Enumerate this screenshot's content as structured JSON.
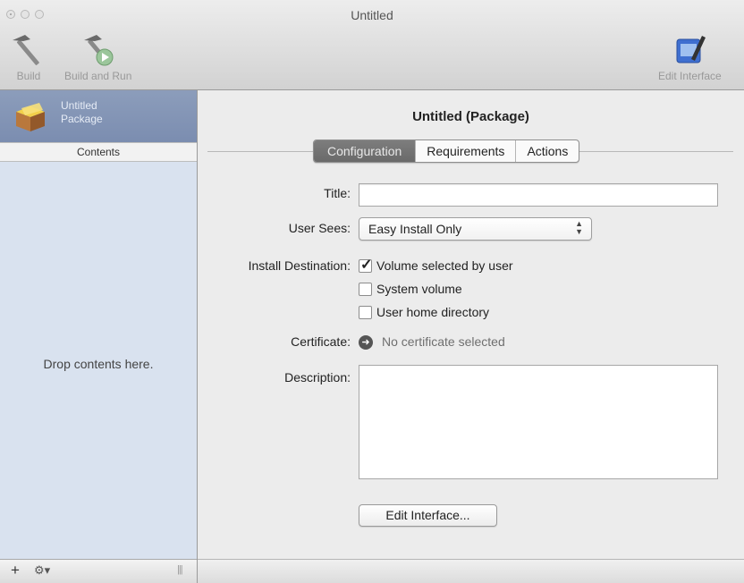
{
  "window": {
    "title": "Untitled"
  },
  "toolbar": {
    "build_label": "Build",
    "build_run_label": "Build and Run",
    "edit_interface_label": "Edit Interface"
  },
  "sidebar": {
    "item": {
      "line1": "Untitled",
      "line2": "Package",
      "icon": "package-icon"
    },
    "header": "Contents",
    "placeholder": "Drop contents here.",
    "footer": {
      "add": "+",
      "gear": "⚙▾",
      "resize": "|||"
    }
  },
  "main": {
    "title": "Untitled (Package)",
    "tabs": [
      {
        "label": "Configuration",
        "active": true
      },
      {
        "label": "Requirements",
        "active": false
      },
      {
        "label": "Actions",
        "active": false
      }
    ],
    "form": {
      "title_label": "Title:",
      "title_value": "",
      "user_sees_label": "User Sees:",
      "user_sees_value": "Easy Install Only",
      "install_destination_label": "Install Destination:",
      "destinations": [
        {
          "label": "Volume selected by user",
          "checked": true
        },
        {
          "label": "System volume",
          "checked": false
        },
        {
          "label": "User home directory",
          "checked": false
        }
      ],
      "certificate_label": "Certificate:",
      "certificate_value": "No certificate selected",
      "description_label": "Description:",
      "description_value": "",
      "edit_button": "Edit Interface..."
    }
  },
  "colors": {
    "sidebar_bg": "#d9e2ef",
    "sidebar_selection": "#8294b5",
    "window_bg": "#ececec",
    "active_tab": "#717171"
  }
}
